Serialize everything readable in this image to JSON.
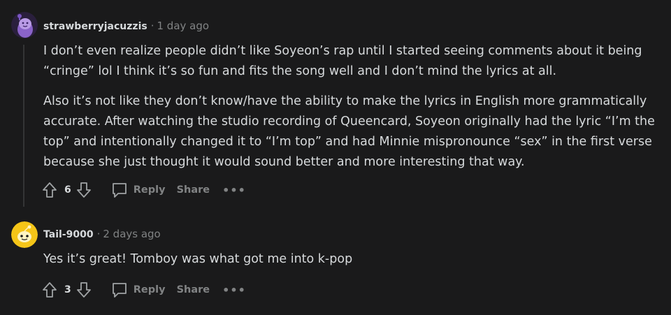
{
  "comments": [
    {
      "username": "strawberryjacuzzis",
      "separator": "·",
      "time": "1 day ago",
      "paragraphs": [
        "I don’t even realize people didn’t like Soyeon’s rap until I started seeing comments about it being “cringe” lol I think it’s so fun and fits the song well and I don’t mind the lyrics at all.",
        "Also it’s not like they don’t know/have the ability to make the lyrics in English more grammatically accurate. After watching the studio recording of Queencard, Soyeon originally had the lyric “I’m the top” and intentionally changed it to “I’m top” and had Minnie mispronounce “sex” in the first verse because she just thought it would sound better and more interesting that way."
      ],
      "score": "6",
      "reply_label": "Reply",
      "share_label": "Share",
      "more_label": "•••",
      "avatar_icon": "purple-snoo-avatar-icon"
    },
    {
      "username": "Tail-9000",
      "separator": "·",
      "time": "2 days ago",
      "paragraphs": [
        "Yes it’s great! Tomboy was what got me into k-pop"
      ],
      "score": "3",
      "reply_label": "Reply",
      "share_label": "Share",
      "more_label": "•••",
      "avatar_icon": "yellow-snoo-avatar-icon"
    }
  ],
  "colors": {
    "background": "#1a1a1b",
    "text": "#d7dadc",
    "muted": "#818384",
    "thread_line": "#343536"
  }
}
